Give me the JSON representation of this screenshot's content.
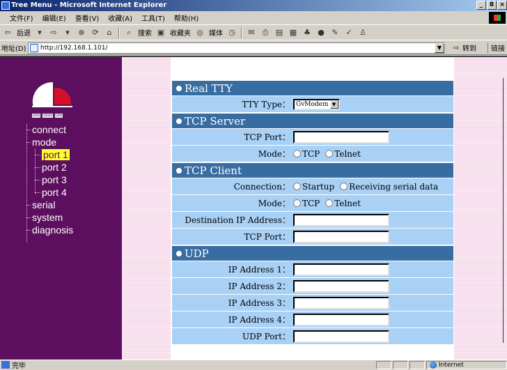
{
  "window": {
    "title": "Tree Menu - Microsoft Internet Explorer",
    "buttons": [
      "_",
      "8",
      "×"
    ]
  },
  "menubar": {
    "items": [
      "文件(F)",
      "编辑(E)",
      "查看(V)",
      "收藏(A)",
      "工具(T)",
      "帮助(H)"
    ]
  },
  "toolbar": {
    "back_label": "后退",
    "search_label": "搜索",
    "favorites_label": "收藏夹",
    "media_label": "媒体"
  },
  "address": {
    "label": "地址(D)",
    "url": "http://192.168.1.101/",
    "go_label": "转到",
    "links_label": "链接"
  },
  "logo": {
    "text": [
      "0000",
      "0000A",
      "VEW"
    ]
  },
  "tree": {
    "items": [
      {
        "label": "connect",
        "level": 0
      },
      {
        "label": "mode",
        "level": 0
      },
      {
        "label": "port 1",
        "level": 1,
        "selected": true
      },
      {
        "label": "port 2",
        "level": 1
      },
      {
        "label": "port 3",
        "level": 1
      },
      {
        "label": "port 4",
        "level": 1
      },
      {
        "label": "serial",
        "level": 0
      },
      {
        "label": "system",
        "level": 0
      },
      {
        "label": "diagnosis",
        "level": 0
      }
    ]
  },
  "form": {
    "real_tty": {
      "title": "Real TTY",
      "tty_type_label": "TTY Type：",
      "tty_type_value": "GvModem"
    },
    "tcp_server": {
      "title": "TCP Server",
      "tcp_port_label": "TCP Port：",
      "mode_label": "Mode：",
      "opt_tcp": "TCP",
      "opt_telnet": "Telnet"
    },
    "tcp_client": {
      "title": "TCP Client",
      "connection_label": "Connection：",
      "opt_startup": "Startup",
      "opt_receiving": "Receiving serial data",
      "mode_label": "Mode：",
      "opt_tcp": "TCP",
      "opt_telnet": "Telnet",
      "dest_ip_label": "Destination IP Address：",
      "tcp_port_label": "TCP Port："
    },
    "udp": {
      "title": "UDP",
      "ip1_label": "IP Address 1：",
      "ip2_label": "IP Address 2：",
      "ip3_label": "IP Address 3：",
      "ip4_label": "IP Address 4：",
      "udp_port_label": "UDP Port："
    }
  },
  "status": {
    "text": "完毕",
    "zone": "Internet"
  },
  "colors": {
    "sidebar": "#5c0f5e",
    "section_header": "#386da2",
    "row_bg": "#a9d0f5",
    "selected_tree": "#ffff33"
  }
}
